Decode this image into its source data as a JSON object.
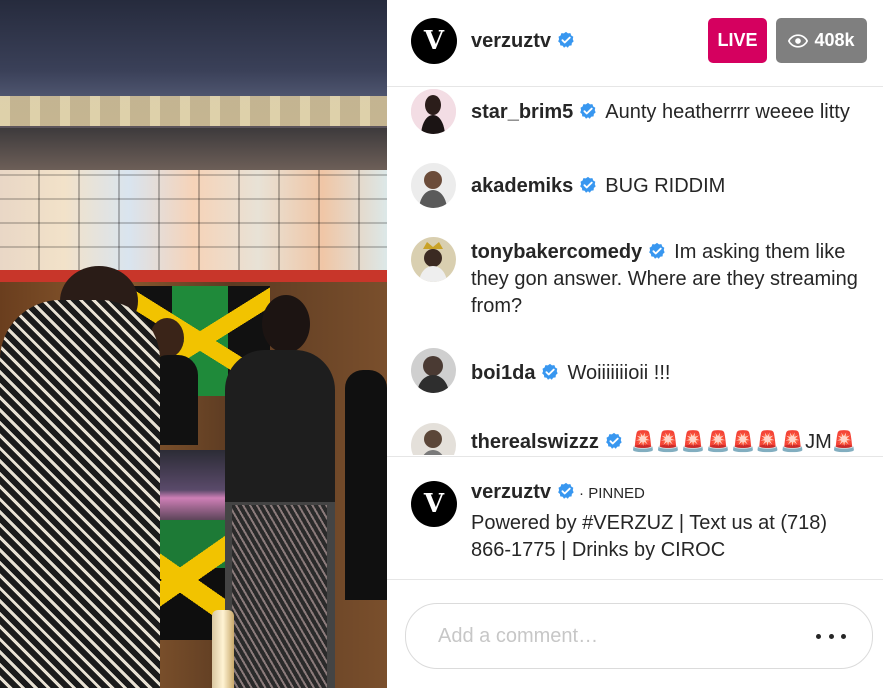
{
  "header": {
    "avatar_letter": "V",
    "username": "verzuztv",
    "live_label": "LIVE",
    "viewer_count": "408k"
  },
  "comments": [
    {
      "username": "star_brim5",
      "verified": true,
      "text": "Aunty heatherrrr weeee litty"
    },
    {
      "username": "akademiks",
      "verified": true,
      "text": "BUG RIDDIM"
    },
    {
      "username": "tonybakercomedy",
      "verified": true,
      "text": "Im asking them like they gon answer. Where are they streaming from?"
    },
    {
      "username": "boi1da",
      "verified": true,
      "text": "Woiiiiiiioii !!!"
    },
    {
      "username": "therealswizzz",
      "verified": true,
      "text": "🚨🚨🚨🚨🚨🚨🚨JM🚨"
    }
  ],
  "pinned": {
    "avatar_letter": "V",
    "username": "verzuztv",
    "tag": "· PINNED",
    "text": "Powered by #VERZUZ | Text us at (718) 866-1775 | Drinks by CIROC"
  },
  "composer": {
    "placeholder": "Add a comment…"
  },
  "colors": {
    "live": "#d5005f",
    "viewers_badge": "#7f7f7f",
    "verified": "#3897f0"
  }
}
